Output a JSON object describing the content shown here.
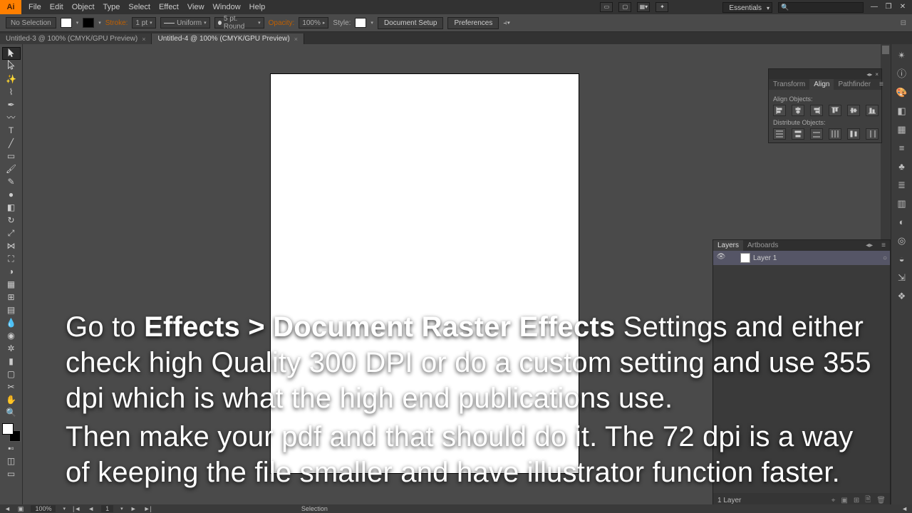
{
  "app": {
    "icon_label": "Ai"
  },
  "menu": [
    "File",
    "Edit",
    "Object",
    "Type",
    "Select",
    "Effect",
    "View",
    "Window",
    "Help"
  ],
  "workspace_selector": "Essentials",
  "options": {
    "selection": "No Selection",
    "stroke_label": "Stroke:",
    "stroke_val": "1 pt",
    "stroke_style": "Uniform",
    "brush": "5 pt. Round",
    "opacity_label": "Opacity:",
    "opacity_val": "100%",
    "style_label": "Style:",
    "doc_setup": "Document Setup",
    "prefs": "Preferences"
  },
  "tabs": [
    {
      "label": "Untitled-3 @ 100% (CMYK/GPU Preview)",
      "active": false
    },
    {
      "label": "Untitled-4 @ 100% (CMYK/GPU Preview)",
      "active": true
    }
  ],
  "align_panel": {
    "tabs": [
      "Transform",
      "Align",
      "Pathfinder"
    ],
    "active_tab": 1,
    "sect1": "Align Objects:",
    "sect2": "Distribute Objects:"
  },
  "layers_panel": {
    "tabs": [
      "Layers",
      "Artboards"
    ],
    "active_tab": 0,
    "layer_name": "Layer 1",
    "footer": "1 Layer"
  },
  "status": {
    "zoom": "100%",
    "page": "1",
    "tool": "Selection"
  },
  "caption_p1_a": "Go to ",
  "caption_p1_b": "Effects > Document Raster Effects",
  "caption_p1_c": " Settings and either check high Quality 300 DPI or do a custom setting and use 355 dpi which is what the high end publications use.",
  "caption_p2": "Then make your pdf and that should do it. The 72 dpi is a way of keeping the file smaller and have illustrator function faster."
}
